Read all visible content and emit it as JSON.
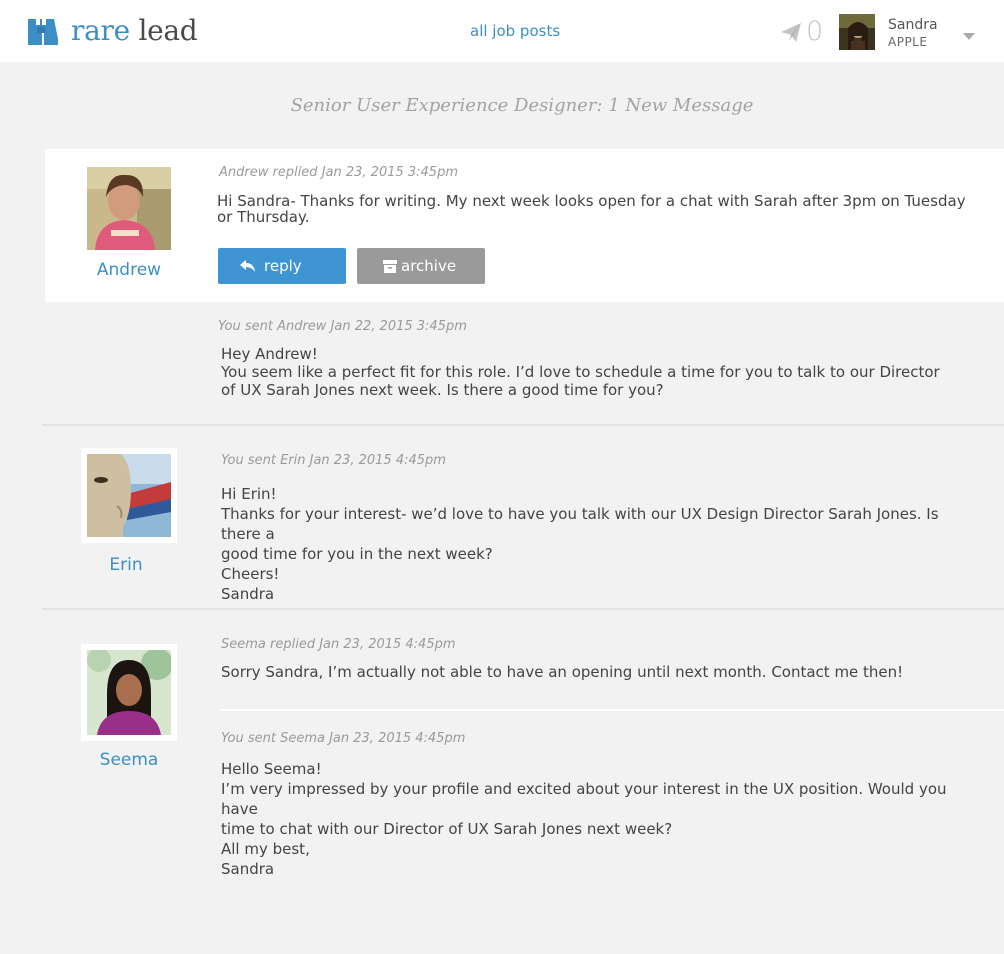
{
  "header": {
    "logo_word1": "rare",
    "logo_word2": "lead",
    "nav_link": "all job posts",
    "sent_count": "0",
    "user_name": "Sandra",
    "user_company": "APPLE"
  },
  "colors": {
    "accent": "#3c8fc4",
    "reply_button": "#3f95d2",
    "archive_button": "#9a9a9a",
    "page_bg": "#f2f2f2"
  },
  "thread": {
    "title": "Senior User Experience Designer: 1 New Message"
  },
  "conversations": [
    {
      "name": "Andrew",
      "messages": [
        {
          "meta": "Andrew replied Jan 23, 2015  3:45pm",
          "body": "Hi Sandra- Thanks for writing. My next week looks open for a chat with Sarah after 3pm on Tuesday\nor Thursday."
        },
        {
          "meta": "You sent Andrew Jan 22, 2015  3:45pm",
          "body": "Hey Andrew!\nYou seem like a perfect fit for this role. I’d love to schedule a time for you to talk to our Director\nof UX Sarah Jones next week. Is there a good time for you?"
        }
      ],
      "reply_label": "reply",
      "archive_label": "archive"
    },
    {
      "name": "Erin",
      "messages": [
        {
          "meta": "You sent Erin Jan 23, 2015  4:45pm",
          "body": "Hi Erin!\nThanks for your interest- we’d love to have you talk with our UX Design Director Sarah Jones. Is there a\ngood time for you in the next week?\nCheers!\nSandra"
        }
      ]
    },
    {
      "name": "Seema",
      "messages": [
        {
          "meta": "Seema replied Jan 23, 2015  4:45pm",
          "body": "Sorry Sandra, I’m actually not able to have an opening until next month. Contact me then!"
        },
        {
          "meta": "You sent Seema Jan 23, 2015  4:45pm",
          "body": "Hello Seema!\nI’m very impressed by your profile and excited about your interest in the UX position. Would you have\ntime to chat with our Director of UX Sarah Jones next week?\nAll my best,\nSandra"
        }
      ]
    }
  ]
}
